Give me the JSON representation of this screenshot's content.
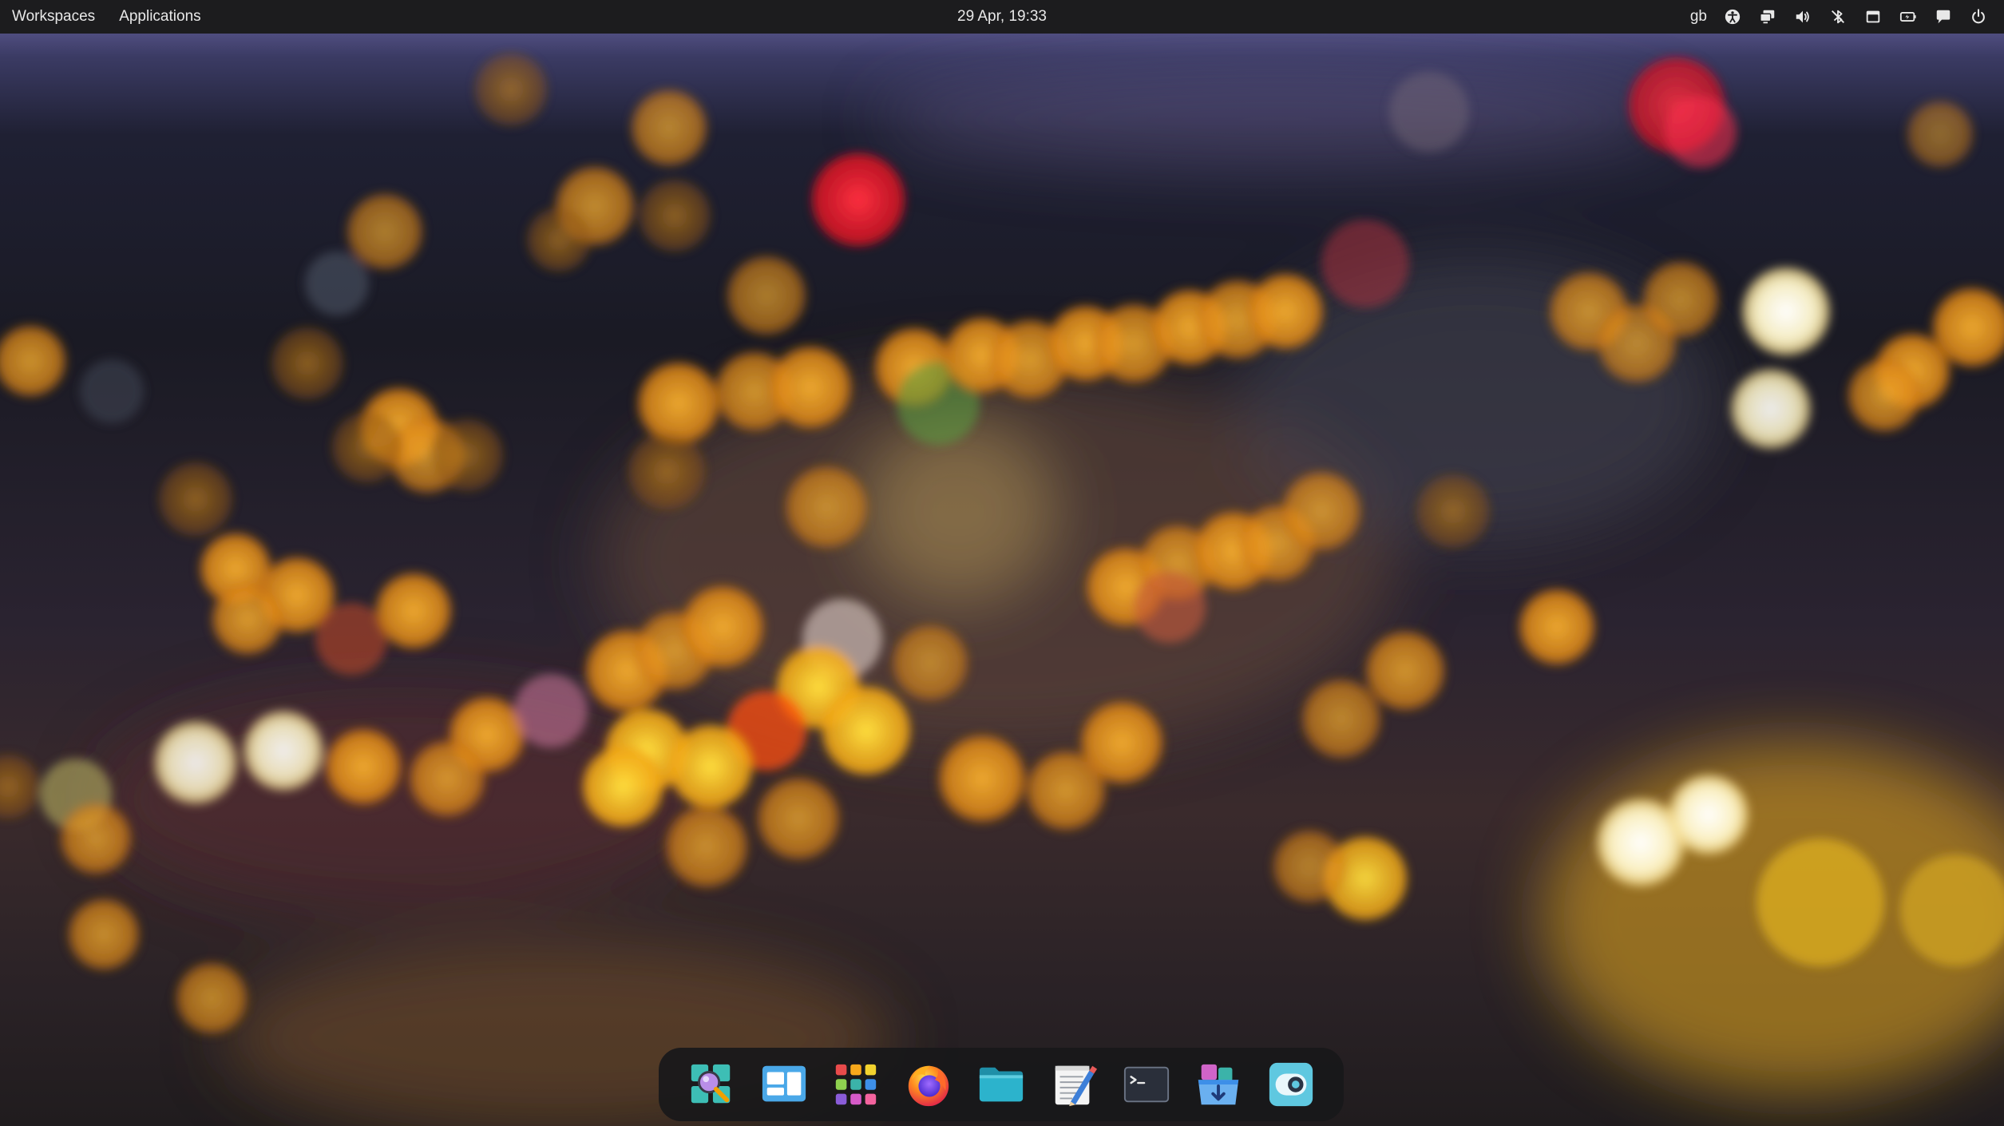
{
  "topbar": {
    "workspaces_label": "Workspaces",
    "applications_label": "Applications",
    "clock": "29 Apr, 19:33",
    "keyboard_layout": "gb",
    "indicators": [
      "accessibility-icon",
      "display-icon",
      "volume-icon",
      "bluetooth-icon",
      "notifications-icon",
      "battery-icon",
      "chat-icon",
      "power-icon"
    ]
  },
  "dock": {
    "items": [
      {
        "name": "search-app-icon"
      },
      {
        "name": "multitasking-view-icon"
      },
      {
        "name": "applications-grid-icon"
      },
      {
        "name": "firefox-icon"
      },
      {
        "name": "files-icon"
      },
      {
        "name": "text-editor-icon"
      },
      {
        "name": "terminal-icon"
      },
      {
        "name": "app-store-icon"
      },
      {
        "name": "system-settings-icon"
      }
    ]
  },
  "colors": {
    "topbar_bg": "#1c1c1e",
    "dock_bg": "#18181a",
    "bokeh_orange": "#f0a020",
    "bokeh_red": "#ff2030",
    "bokeh_white": "#fff8d8"
  }
}
